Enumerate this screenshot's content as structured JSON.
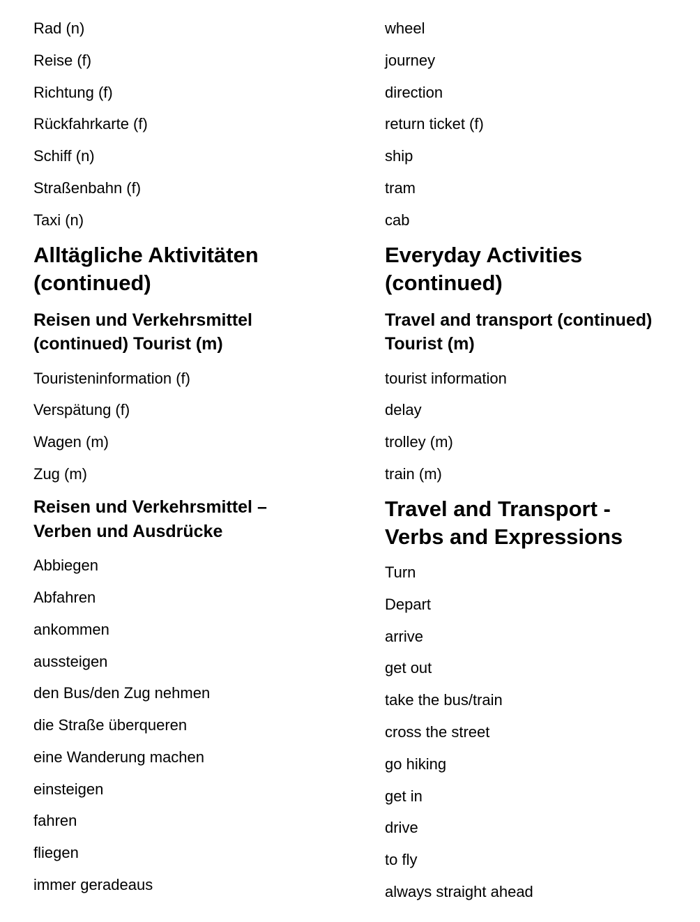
{
  "german": {
    "group1": [
      "Rad (n)",
      "Reise (f)",
      "Richtung (f)",
      "Rückfahrkarte (f)",
      "Schiff (n)",
      "Straßenbahn (f)",
      "Taxi (n)"
    ],
    "heading_main": [
      "Alltägliche Aktivitäten",
      "(continued)"
    ],
    "heading_sub": [
      "Reisen und Verkehrsmittel",
      "(continued) Tourist (m)"
    ],
    "group2": [
      "Touristeninformation (f)",
      "Verspätung (f)",
      "Wagen (m)",
      "Zug (m)"
    ],
    "heading_verbs": [
      "Reisen und Verkehrsmittel –",
      "Verben und Ausdrücke"
    ],
    "group3": [
      "Abbiegen",
      "Abfahren",
      "ankommen",
      "aussteigen",
      "den Bus/den Zug nehmen",
      "die Straße überqueren",
      "eine Wanderung machen",
      "einsteigen",
      "fahren",
      "fliegen",
      "immer geradeaus"
    ]
  },
  "english": {
    "group1": [
      "wheel",
      "journey",
      "direction",
      "return ticket (f)",
      "ship",
      "tram",
      "cab"
    ],
    "heading_main": [
      "Everyday Activities",
      "(continued)"
    ],
    "heading_sub": [
      "Travel and transport (continued)",
      "Tourist (m)"
    ],
    "group2": [
      "tourist information",
      "delay",
      "trolley (m)",
      "train (m)"
    ],
    "heading_verbs": [
      "Travel and Transport -",
      "Verbs and Expressions"
    ],
    "group3": [
      "Turn",
      "Depart",
      "arrive",
      "get out",
      "take the bus/train",
      "cross the street",
      "go hiking",
      "get in",
      "drive",
      "to fly",
      "always straight ahead"
    ]
  }
}
